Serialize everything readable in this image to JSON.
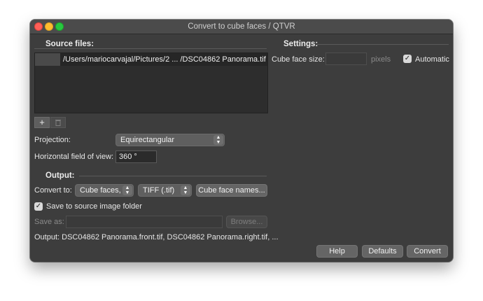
{
  "window": {
    "title": "Convert to cube faces / QTVR"
  },
  "source": {
    "title": "Source files:",
    "files": [
      "/Users/mariocarvajal/Pictures/2  ...  /DSC04862 Panorama.tif"
    ],
    "add_label": "+",
    "remove_icon": "trash-icon"
  },
  "projection": {
    "label": "Projection:",
    "value": "Equirectangular"
  },
  "hfov": {
    "label": "Horizontal field of view:",
    "value": "360 °"
  },
  "output": {
    "title": "Output:",
    "convert_label": "Convert to:",
    "convert_value": "Cube faces,",
    "format_value": "TIFF (.tif)",
    "names_button": "Cube face names...",
    "save_to_source_label": "Save to source image folder",
    "save_to_source_checked": true,
    "save_as_label": "Save as:",
    "save_as_value": "",
    "browse_label": "Browse...",
    "summary": "Output: DSC04862 Panorama.front.tif, DSC04862 Panorama.right.tif, ..."
  },
  "settings": {
    "title": "Settings:",
    "cube_face_size_label": "Cube face size:",
    "cube_face_size_value": "",
    "unit": "pixels",
    "automatic_label": "Automatic",
    "automatic_checked": true
  },
  "buttons": {
    "help": "Help",
    "defaults": "Defaults",
    "convert": "Convert"
  }
}
